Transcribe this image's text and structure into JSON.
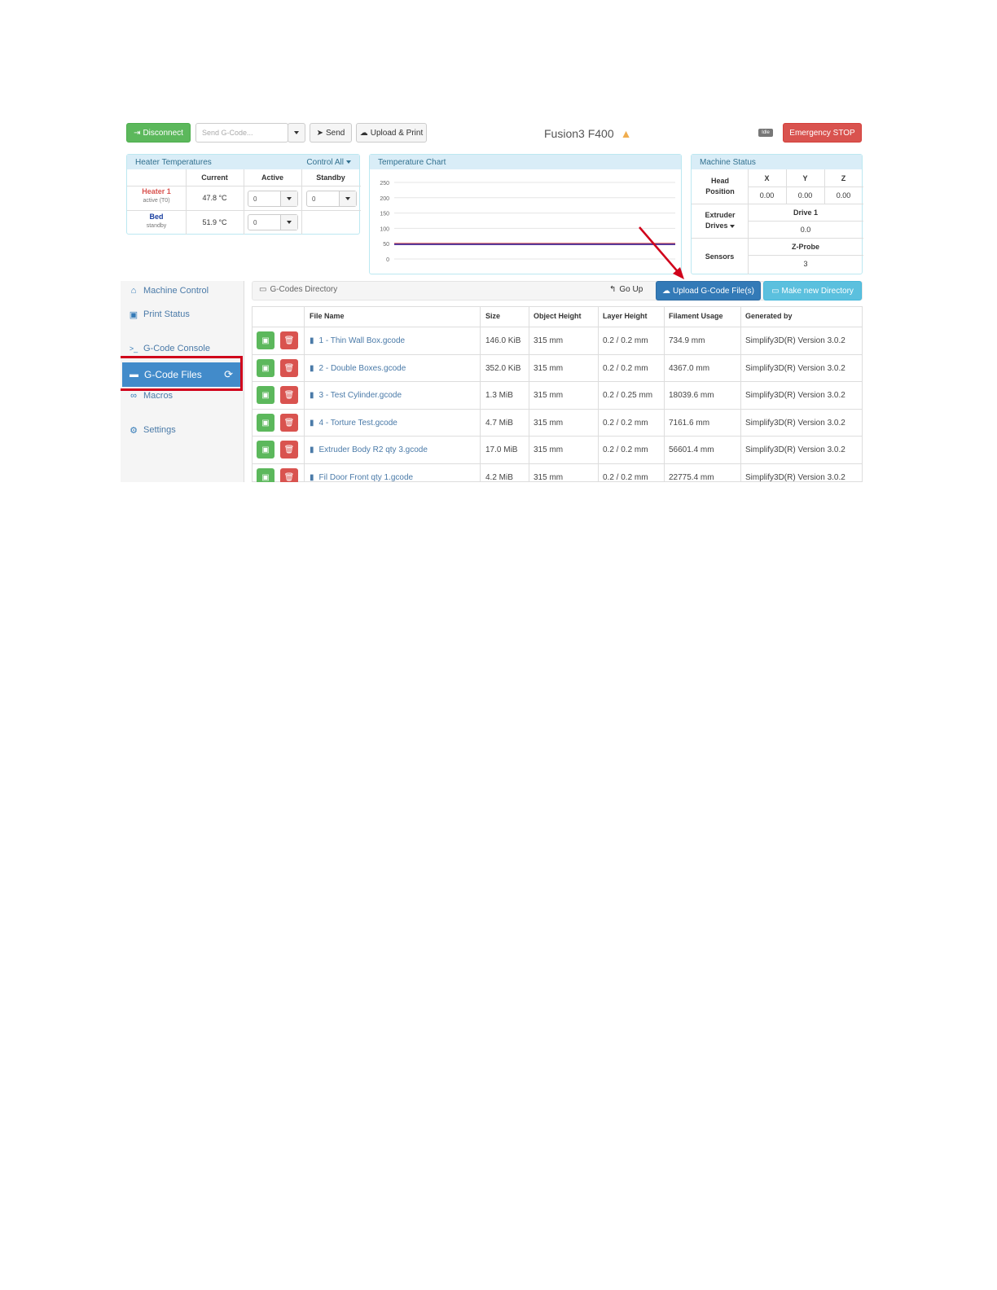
{
  "topbar": {
    "disconnect_label": "Disconnect",
    "gcode_placeholder": "Send G-Code...",
    "send_label": "Send",
    "upload_print_label": "Upload & Print",
    "machine_name": "Fusion3 F400",
    "status_badge": "Idle",
    "emergency_label": "Emergency STOP"
  },
  "heaters": {
    "title": "Heater Temperatures",
    "control_all": "Control All",
    "col_current": "Current",
    "col_active": "Active",
    "col_standby": "Standby",
    "rows": [
      {
        "name": "Heater 1",
        "sub": "active (T0)",
        "current": "47.8 °C",
        "active": "0",
        "standby": "0"
      },
      {
        "name": "Bed",
        "sub": "standby",
        "current": "51.9 °C",
        "active": "0",
        "standby": ""
      }
    ]
  },
  "temperature_chart": {
    "title": "Temperature Chart",
    "y_ticks": [
      "250",
      "200",
      "150",
      "100",
      "50",
      "0"
    ]
  },
  "chart_data": {
    "type": "line",
    "title": "Temperature Chart",
    "ylim": [
      0,
      250
    ],
    "series": [
      {
        "name": "Heater 1",
        "color": "#d9534f",
        "values": [
          50,
          50,
          50,
          50,
          50
        ]
      },
      {
        "name": "Bed",
        "color": "#5b3a99",
        "values": [
          50,
          50,
          50,
          50,
          50
        ]
      }
    ]
  },
  "machine_status": {
    "title": "Machine Status",
    "head_position_label": "Head Position",
    "axes": [
      "X",
      "Y",
      "Z"
    ],
    "positions": [
      "0.00",
      "0.00",
      "0.00"
    ],
    "extruder_label": "Extruder Drives",
    "drive_label": "Drive 1",
    "drive_value": "0.0",
    "sensors_label": "Sensors",
    "probe_label": "Z-Probe",
    "probe_value": "3"
  },
  "sidebar": {
    "items": [
      {
        "label": "Machine Control",
        "icon": "home-icon"
      },
      {
        "label": "Print Status",
        "icon": "print-icon"
      },
      {
        "label": "G-Code Console",
        "icon": "console-icon"
      },
      {
        "label": "G-Code Files",
        "icon": "hdd-icon"
      },
      {
        "label": "Macros",
        "icon": "link-icon"
      },
      {
        "label": "Settings",
        "icon": "gear-icon"
      }
    ]
  },
  "files": {
    "directory_label": "G-Codes Directory",
    "go_up_label": "Go Up",
    "upload_label": "Upload G-Code File(s)",
    "new_dir_label": "Make new Directory",
    "columns": [
      "File Name",
      "Size",
      "Object Height",
      "Layer Height",
      "Filament Usage",
      "Generated by"
    ],
    "rows": [
      {
        "name": "1 - Thin Wall Box.gcode",
        "size": "146.0 KiB",
        "object_height": "315 mm",
        "layer_height": "0.2 / 0.2 mm",
        "filament": "734.9 mm",
        "generated_by": "Simplify3D(R) Version 3.0.2"
      },
      {
        "name": "2 - Double Boxes.gcode",
        "size": "352.0 KiB",
        "object_height": "315 mm",
        "layer_height": "0.2 / 0.2 mm",
        "filament": "4367.0 mm",
        "generated_by": "Simplify3D(R) Version 3.0.2"
      },
      {
        "name": "3 - Test Cylinder.gcode",
        "size": "1.3 MiB",
        "object_height": "315 mm",
        "layer_height": "0.2 / 0.25 mm",
        "filament": "18039.6 mm",
        "generated_by": "Simplify3D(R) Version 3.0.2"
      },
      {
        "name": "4 - Torture Test.gcode",
        "size": "4.7 MiB",
        "object_height": "315 mm",
        "layer_height": "0.2 / 0.2 mm",
        "filament": "7161.6 mm",
        "generated_by": "Simplify3D(R) Version 3.0.2"
      },
      {
        "name": "Extruder Body R2 qty 3.gcode",
        "size": "17.0 MiB",
        "object_height": "315 mm",
        "layer_height": "0.2 / 0.2 mm",
        "filament": "56601.4 mm",
        "generated_by": "Simplify3D(R) Version 3.0.2"
      },
      {
        "name": "Fil Door Front qty 1.gcode",
        "size": "4.2 MiB",
        "object_height": "315 mm",
        "layer_height": "0.2 / 0.2 mm",
        "filament": "22775.4 mm",
        "generated_by": "Simplify3D(R) Version 3.0.2"
      }
    ]
  },
  "colors": {
    "annotation_red": "#d0021b",
    "accent_blue": "#428bca"
  }
}
